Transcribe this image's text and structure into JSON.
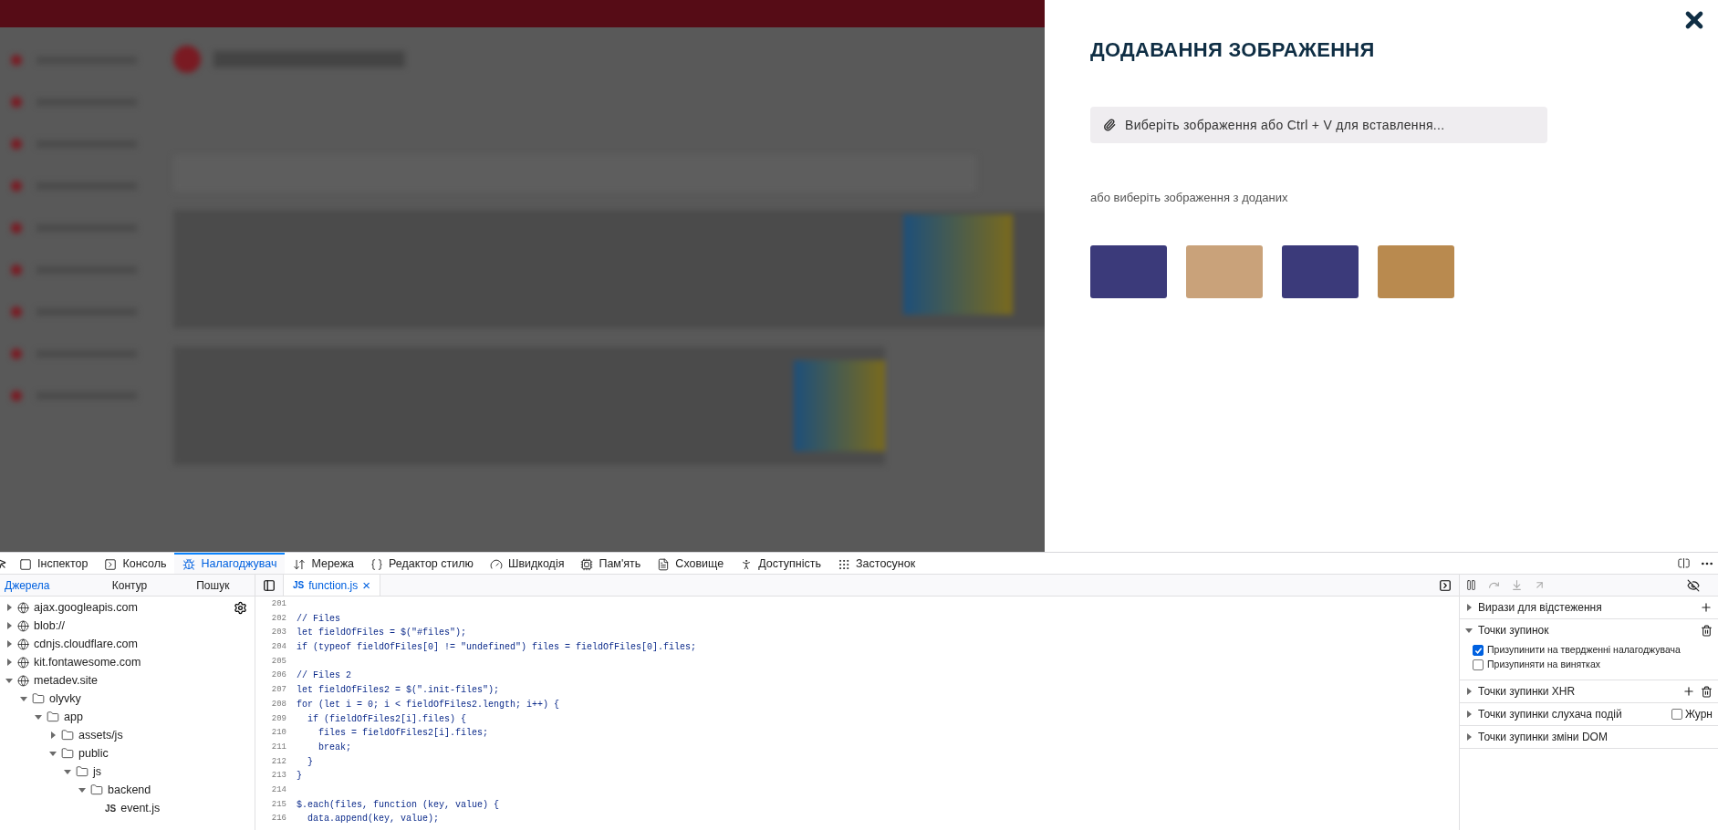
{
  "modal": {
    "title": "ДОДАВАННЯ ЗОБРАЖЕННЯ",
    "upload_button": "Виберіть зображення або Ctrl + V для вставлення...",
    "hint": "або виберіть зображення з доданих"
  },
  "devtools": {
    "tabs": [
      {
        "label": "Інспектор",
        "selected": false
      },
      {
        "label": "Консоль",
        "selected": false
      },
      {
        "label": "Налагоджувач",
        "selected": true
      },
      {
        "label": "Мережа",
        "selected": false
      },
      {
        "label": "Редактор стилю",
        "selected": false
      },
      {
        "label": "Швидкодія",
        "selected": false
      },
      {
        "label": "Пам'ять",
        "selected": false
      },
      {
        "label": "Сховище",
        "selected": false
      },
      {
        "label": "Доступність",
        "selected": false
      },
      {
        "label": "Застосунок",
        "selected": false
      }
    ],
    "source_tabs": [
      {
        "label": "Джерела",
        "selected": true
      },
      {
        "label": "Контур",
        "selected": false
      },
      {
        "label": "Пошук",
        "selected": false
      }
    ],
    "tree": [
      {
        "label": "ajax.googleapis.com",
        "kind": "domain",
        "expanded": false
      },
      {
        "label": "blob://",
        "kind": "domain",
        "expanded": false
      },
      {
        "label": "cdnjs.cloudflare.com",
        "kind": "domain",
        "expanded": false
      },
      {
        "label": "kit.fontawesome.com",
        "kind": "domain",
        "expanded": false
      },
      {
        "label": "metadev.site",
        "kind": "domain",
        "expanded": true,
        "children": [
          {
            "label": "olyvky",
            "kind": "folder",
            "expanded": true,
            "children": [
              {
                "label": "app",
                "kind": "folder",
                "expanded": true,
                "children": [
                  {
                    "label": "assets/js",
                    "kind": "folder",
                    "expanded": false
                  },
                  {
                    "label": "public",
                    "kind": "folder",
                    "expanded": true,
                    "children": [
                      {
                        "label": "js",
                        "kind": "folder",
                        "expanded": true,
                        "children": [
                          {
                            "label": "backend",
                            "kind": "folder",
                            "expanded": true,
                            "children": [
                              {
                                "label": "event.js",
                                "kind": "file",
                                "badge": "JS"
                              }
                            ]
                          }
                        ]
                      }
                    ]
                  }
                ]
              }
            ]
          }
        ]
      }
    ],
    "editor_tab": {
      "badge": "JS",
      "label": "function.js",
      "close": "×"
    },
    "code": [
      {
        "number": "201"
      },
      {
        "number": "202",
        "text": "// Files"
      },
      {
        "number": "203",
        "text": "let fieldOfFiles = $(\"#files\");"
      },
      {
        "number": "204",
        "text": "if (typeof fieldOfFiles[0] != \"undefined\") files = fieldOfFiles[0].files;"
      },
      {
        "number": "205"
      },
      {
        "number": "206",
        "text": "// Files 2"
      },
      {
        "number": "207",
        "text": "let fieldOfFiles2 = $(\".init-files\");"
      },
      {
        "number": "208",
        "text": "for (let i = 0; i < fieldOfFiles2.length; i++) {"
      },
      {
        "number": "209",
        "text": "  if (fieldOfFiles2[i].files) {"
      },
      {
        "number": "210",
        "text": "    files = fieldOfFiles2[i].files;"
      },
      {
        "number": "211",
        "text": "    break;"
      },
      {
        "number": "212",
        "text": "  }"
      },
      {
        "number": "213",
        "text": "}"
      },
      {
        "number": "214"
      },
      {
        "number": "215",
        "text": "$.each(files, function (key, value) {"
      },
      {
        "number": "216",
        "text": "  data.append(key, value);"
      }
    ],
    "sections": [
      {
        "label": "Вирази для відстеження",
        "expanded": false
      },
      {
        "label": "Точки зупинок",
        "expanded": true,
        "options": [
          {
            "label": "Призупинити на твердженні налагоджувача",
            "checked": true
          },
          {
            "label": "Призупиняти на винятках",
            "checked": false
          }
        ]
      },
      {
        "label": "Точки зупинки XHR",
        "expanded": false
      },
      {
        "label": "Точки зупинки слухача подій",
        "expanded": false,
        "toggle": {
          "label": "Журн",
          "checked": false
        }
      },
      {
        "label": "Точки зупинки зміни DOM",
        "expanded": false
      }
    ]
  }
}
